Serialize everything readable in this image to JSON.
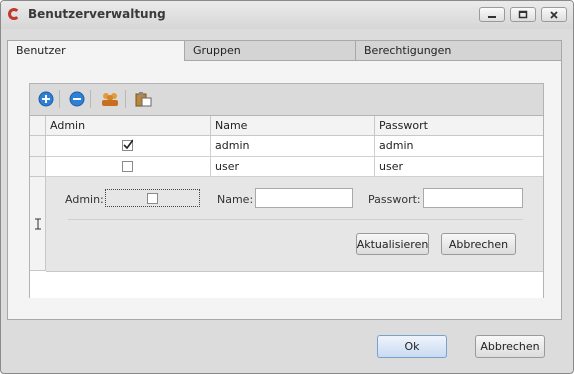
{
  "window": {
    "title": "Benutzerverwaltung"
  },
  "tabs": [
    {
      "label": "Benutzer",
      "active": true
    },
    {
      "label": "Gruppen",
      "active": false
    },
    {
      "label": "Berechtigungen",
      "active": false
    }
  ],
  "toolbar": {
    "icons": [
      "add-icon",
      "remove-icon",
      "users-group-icon",
      "paste-icon"
    ]
  },
  "grid": {
    "columns": [
      "Admin",
      "Name",
      "Passwort"
    ],
    "rows": [
      {
        "admin": true,
        "name": "admin",
        "password": "admin"
      },
      {
        "admin": false,
        "name": "user",
        "password": "user"
      }
    ]
  },
  "edit_form": {
    "admin_label": "Admin:",
    "admin_checked": false,
    "name_label": "Name:",
    "name_value": "",
    "password_label": "Passwort:",
    "password_value": "",
    "update_button": "Aktualisieren",
    "cancel_button": "Abbrechen"
  },
  "footer": {
    "ok_button": "Ok",
    "cancel_button": "Abbrechen"
  },
  "colors": {
    "accent": "#7aa0cf",
    "app_icon": "#c0392b",
    "toolbar_icon_blue": "#2f7fd6"
  }
}
